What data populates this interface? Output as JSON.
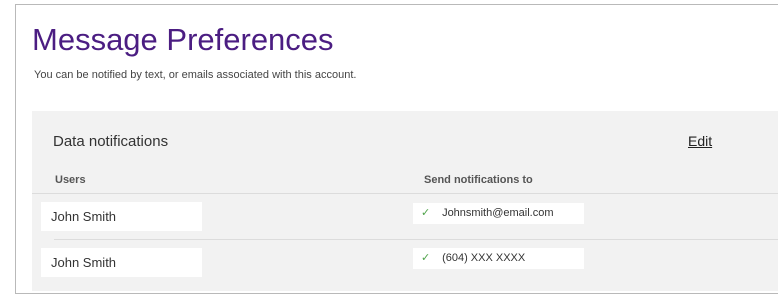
{
  "page": {
    "title": "Message Preferences",
    "subtitle": "You can be notified by text, or emails associated with this account."
  },
  "section": {
    "title": "Data notifications",
    "edit_label": "Edit",
    "columns": {
      "users": "Users",
      "send_to": "Send notifications to"
    },
    "rows": [
      {
        "user": "John Smith",
        "contact": "Johnsmith@email.com",
        "check_icon": "✓"
      },
      {
        "user": "John Smith",
        "contact": "(604) XXX XXXX",
        "check_icon": "✓"
      }
    ]
  },
  "colors": {
    "title": "#4b1d82",
    "check": "#4fa34a",
    "panel": "#f2f2f2"
  }
}
